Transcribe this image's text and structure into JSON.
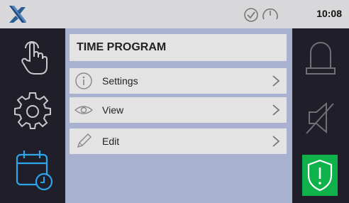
{
  "header": {
    "time": "10:08"
  },
  "icons": {
    "logo": "x-logo",
    "status": [
      "check-circle-icon",
      "gauge-icon"
    ],
    "left_nav": [
      "touch-hand-icon",
      "gear-icon",
      "calendar-clock-icon"
    ],
    "right_nav": [
      "beacon-icon",
      "speaker-muted-icon",
      "shield-alert-icon"
    ]
  },
  "colors": {
    "alert_green": "#0fb24a",
    "accent_blue": "#2ea4ea",
    "panel_bg": "#a9b1d1"
  },
  "main": {
    "title": "TIME PROGRAM",
    "menu": [
      {
        "label": "Settings",
        "icon": "info-circle-icon"
      },
      {
        "label": "View",
        "icon": "eye-icon"
      },
      {
        "label": "Edit",
        "icon": "pencil-icon"
      }
    ]
  }
}
